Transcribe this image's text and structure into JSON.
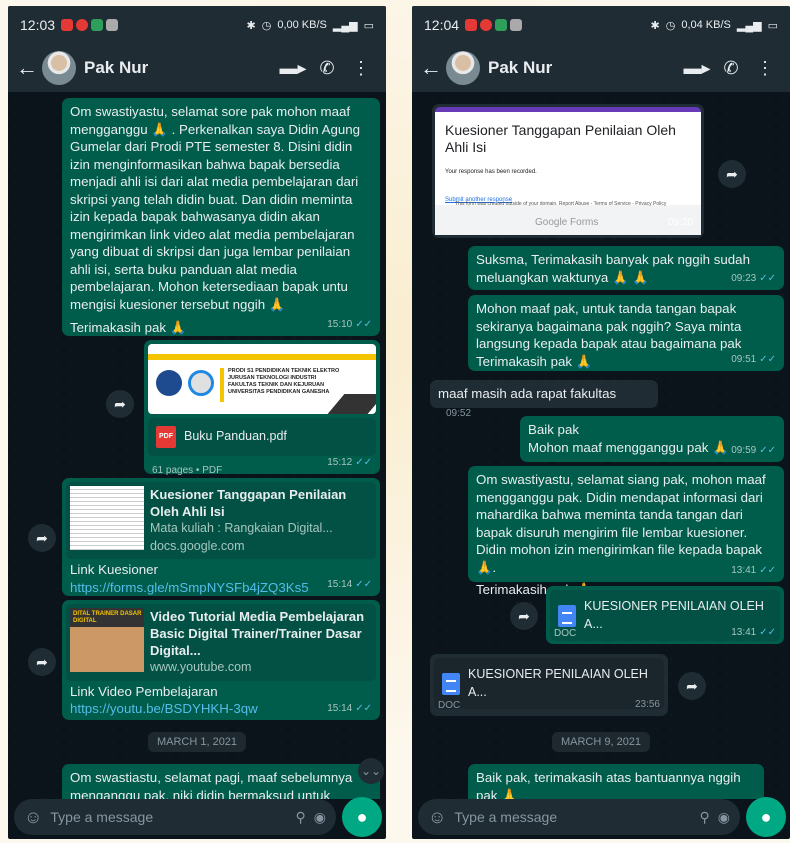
{
  "left": {
    "status": {
      "time": "12:03",
      "net": "0,00 KB/S"
    },
    "contact": "Pak Nur",
    "msg1": {
      "text": "Om swastiyastu, selamat sore pak mohon maaf mengganggu 🙏 . Perkenalkan saya Didin Agung Gumelar dari Prodi PTE semester 8. Disini didin izin menginformasikan bahwa bapak bersedia menjadi ahli isi dari alat media pembelajaran dari skripsi yang telah didin buat. Dan didin meminta izin kepada bapak bahwasanya didin akan mengirimkan link video alat media pembelajaran yang dibuat di skripsi dan juga lembar penilaian ahli isi, serta buku panduan alat media pembelajaran. Mohon ketersediaan bapak untu mengisi kuesioner tersebut nggih 🙏",
      "text2": "Terimakasih pak 🙏",
      "time": "15:10"
    },
    "pdf": {
      "cover1": "PRODI S1 PENDIDIKAN TEKNIK ELEKTRO",
      "cover2": "JURUSAN TEKNOLOGI INDUSTRI",
      "cover3": "FAKULTAS TEKNIK DAN KEJURUAN",
      "cover4": "UNIVERSITAS PENDIDIKAN GANESHA",
      "name": "Buku Panduan.pdf",
      "meta": "61 pages • PDF",
      "time": "15:12",
      "icon_label": "PDF"
    },
    "link1": {
      "title": "Kuesioner Tanggapan Penilaian Oleh Ahli Isi",
      "desc": "Mata kuliah        : Rangkaian Digital...",
      "domain": "docs.google.com",
      "label": "Link Kuesioner",
      "url": "https://forms.gle/mSmpNYSFb4jZQ3Ks5",
      "time": "15:14"
    },
    "link2": {
      "thumb_text": "DITAL TRAINER DASAR DIGITAL",
      "title": "Video Tutorial Media Pembelajaran Basic Digital Trainer/Trainer Dasar Digital...",
      "domain": "www.youtube.com",
      "label": "Link Video Pembelajaran",
      "url": "https://youtu.be/BSDYHKH-3qw",
      "time": "15:14"
    },
    "date": "MARCH 1, 2021",
    "msg_last": "Om swastiastu, selamat pagi, maaf sebelumnya menganggu pak, niki didin bermaksud untuk",
    "input_placeholder": "Type a message"
  },
  "right": {
    "status": {
      "time": "12:04",
      "net": "0,04 KB/S"
    },
    "contact": "Pak Nur",
    "form_img": {
      "title": "Kuesioner Tanggapan Penilaian Oleh Ahli Isi",
      "recorded": "Your response has been recorded.",
      "another": "Submit another response",
      "footer": "This form was created outside of your domain. Report Abuse - Terms of Service - Privacy Policy",
      "brand": "Google Forms",
      "time": "09:20"
    },
    "m1": {
      "text": "Suksma, Terimakasih banyak pak nggih sudah meluangkan waktunya 🙏 🙏",
      "time": "09:23"
    },
    "m2": {
      "text": "Mohon maaf pak, untuk tanda tangan  bapak sekiranya bagaimana pak nggih? Saya minta langsung kepada bapak atau bagaimana pak Terimakasih pak 🙏",
      "time": "09:51"
    },
    "m3": {
      "text": "maaf masih ada rapat fakultas",
      "time": "09:52"
    },
    "m4": {
      "text1": "Baik pak",
      "text2": "Mohon maaf mengganggu pak 🙏",
      "time": "09:59"
    },
    "m5": {
      "text": "Om swastiyastu, selamat siang pak, mohon maaf mengganggu pak. Didin mendapat informasi dari mahardika bahwa meminta tanda tangan dari bapak disuruh mengirim file lembar kuesioner. Didin mohon izin mengirimkan file kepada bapak 🙏.",
      "text2": "Terimakasih pak 🙏",
      "time": "13:41"
    },
    "doc_out": {
      "name": "KUESIONER PENILAIAN OLEH A...",
      "type": "DOC",
      "time": "13:41"
    },
    "doc_in": {
      "name": "KUESIONER PENILAIAN OLEH A...",
      "type": "DOC",
      "time": "23:56"
    },
    "date": "MARCH 9, 2021",
    "m6": {
      "text": "Baik pak, terimakasih atas bantuannya nggih pak 🙏"
    },
    "input_placeholder": "Type a message"
  },
  "icons": {
    "read_ticks": "✓✓",
    "back": "←",
    "video": "■◀",
    "call": "✆",
    "menu": "⋮",
    "forward": "➦",
    "emoji": "☺",
    "attach": "📎",
    "camera": "◉",
    "mic": "🎤",
    "scroll": "⌄⌄"
  },
  "colors": {
    "outgoing": "#005c4b",
    "incoming": "#202c33",
    "accent": "#00a884",
    "ticks": "#53bdeb"
  }
}
